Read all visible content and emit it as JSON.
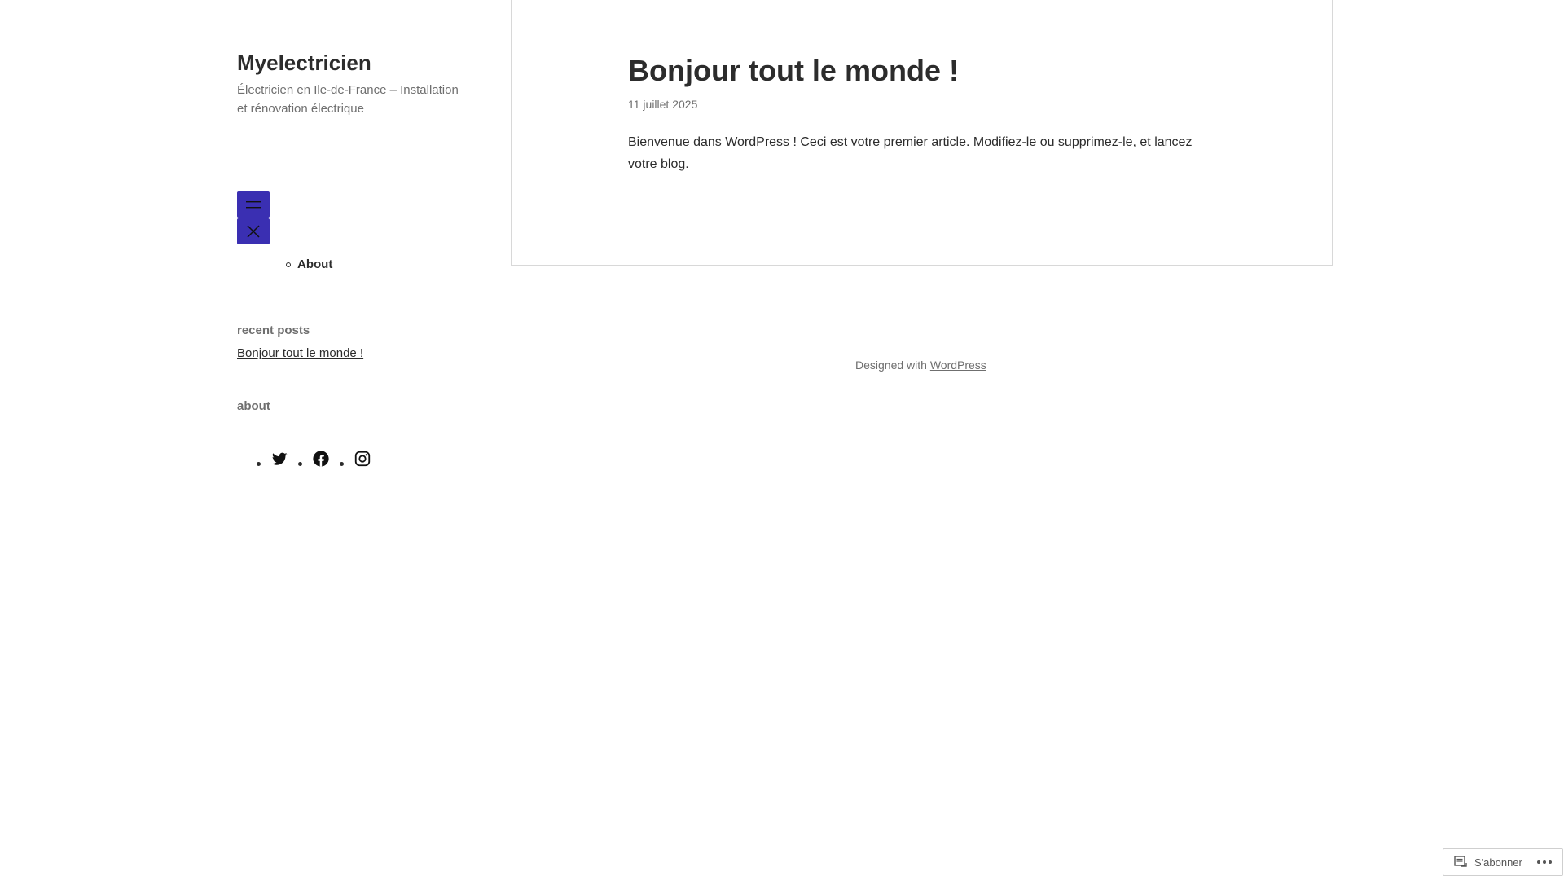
{
  "site": {
    "title": "Myelectricien",
    "description": "Électricien en Ile-de-France – Installation et rénovation électrique"
  },
  "menu": {
    "open_icon": "hamburger-icon",
    "close_icon": "close-icon",
    "accent_color": "#3a2fb2",
    "items": [
      {
        "label": "About"
      }
    ]
  },
  "widgets": {
    "recent_posts": {
      "title": "recent posts",
      "items": [
        {
          "label": "Bonjour tout le monde !"
        }
      ]
    },
    "about": {
      "title": "about"
    },
    "social": {
      "items": [
        {
          "icon": "twitter-icon"
        },
        {
          "icon": "facebook-icon"
        },
        {
          "icon": "instagram-icon"
        }
      ]
    }
  },
  "post": {
    "title": "Bonjour tout le monde !",
    "date": "11 juillet 2025",
    "body": "Bienvenue dans WordPress ! Ceci est votre premier article. Modifiez-le ou supprimez-le, et lancez votre blog."
  },
  "footer": {
    "credit_prefix": "Designed with ",
    "credit_link": "WordPress"
  },
  "subscribe": {
    "label": "S'abonner",
    "icon": "reader-icon",
    "more_icon": "ellipsis-icon"
  }
}
